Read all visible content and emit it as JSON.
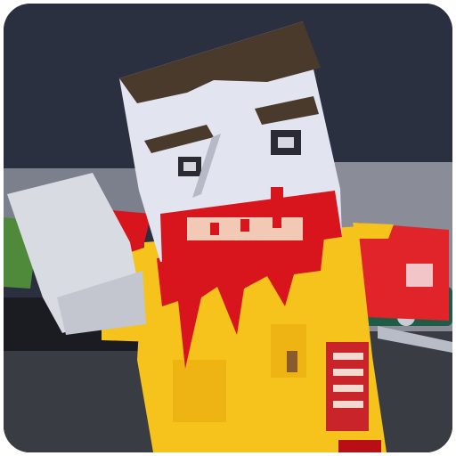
{
  "app": {
    "icon_name": "blocky-zombie-app-icon"
  },
  "scene": {
    "subject": "zombie-character",
    "colors": {
      "sky": "#2b3040",
      "wall": "#8a8d97",
      "ground": "#3a3c44",
      "skin": "#e2e4f0",
      "hair": "#4a3a2c",
      "shirt": "#f6c21c",
      "blood": "#d8141c",
      "sleeve": "#e0242a",
      "fist": "#d9dbe2",
      "car": "#1e5c48"
    }
  }
}
